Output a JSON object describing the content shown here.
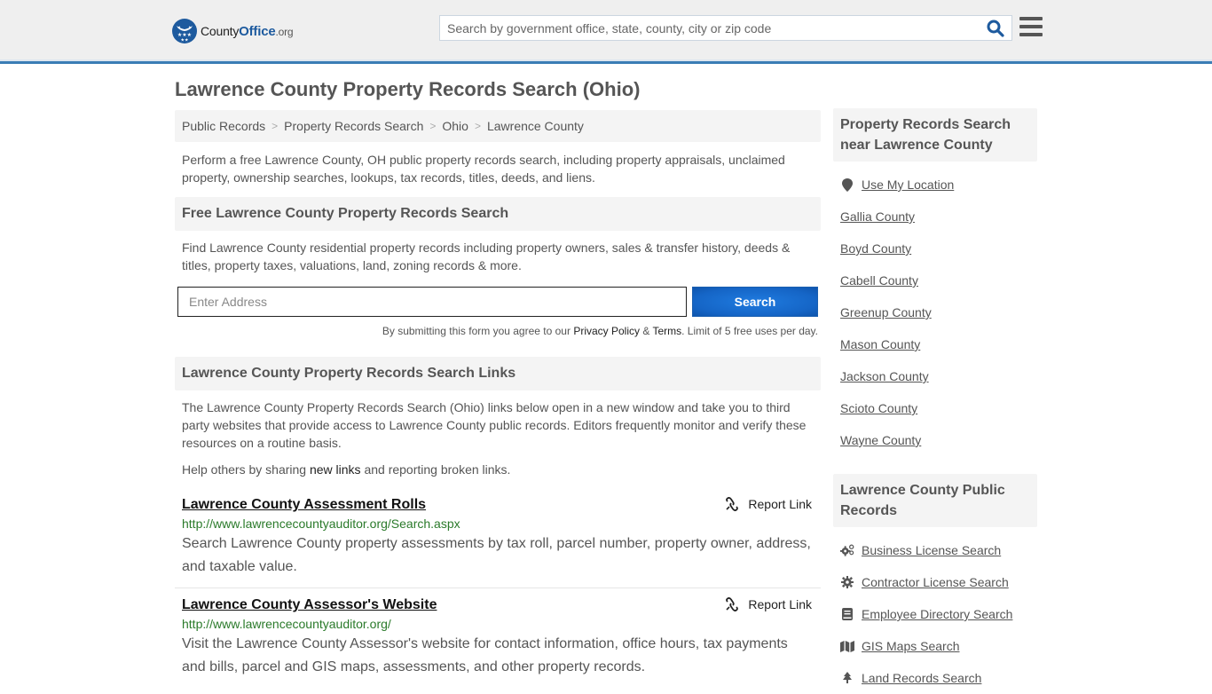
{
  "header": {
    "logo": {
      "name": "County",
      "name_bold": "Office",
      "tld": ".org"
    },
    "search_placeholder": "Search by government office, state, county, city or zip code",
    "search_icon": "magnifier-icon",
    "menu_icon": "hamburger-menu-icon"
  },
  "page_title": "Lawrence County Property Records Search (Ohio)",
  "breadcrumb": [
    "Public Records",
    "Property Records Search",
    "Ohio",
    "Lawrence County"
  ],
  "breadcrumb_separator": ">",
  "intro": "Perform a free Lawrence County, OH public property records search, including property appraisals, unclaimed property, ownership searches, lookups, tax records, titles, deeds, and liens.",
  "free_search": {
    "heading": "Free Lawrence County Property Records Search",
    "description": "Find Lawrence County residential property records including property owners, sales & transfer history, deeds & titles, property taxes, valuations, land, zoning records & more.",
    "address_placeholder": "Enter Address",
    "button_label": "Search",
    "disclaimer_prefix": "By submitting this form you agree to our ",
    "privacy_label": "Privacy Policy",
    "amp": " & ",
    "terms_label": "Terms",
    "disclaimer_suffix": ". Limit of 5 free uses per day."
  },
  "links_section": {
    "heading": "Lawrence County Property Records Search Links",
    "description": "The Lawrence County Property Records Search (Ohio) links below open in a new window and take you to third party websites that provide access to Lawrence County public records. Editors frequently monitor and verify these resources on a routine basis.",
    "help_prefix": "Help others by sharing ",
    "help_link": "new links",
    "help_suffix": " and reporting broken links.",
    "report_label": "Report Link",
    "items": [
      {
        "title": "Lawrence County Assessment Rolls",
        "url": "http://www.lawrencecountyauditor.org/Search.aspx",
        "description": "Search Lawrence County property assessments by tax roll, parcel number, property owner, address, and taxable value."
      },
      {
        "title": "Lawrence County Assessor's Website",
        "url": "http://www.lawrencecountyauditor.org/",
        "description": "Visit the Lawrence County Assessor's website for contact information, office hours, tax payments and bills, parcel and GIS maps, assessments, and other property records."
      }
    ]
  },
  "sidebar": {
    "nearby": {
      "heading": "Property Records Search near Lawrence County",
      "use_location": "Use My Location",
      "counties": [
        "Gallia County",
        "Boyd County",
        "Cabell County",
        "Greenup County",
        "Mason County",
        "Jackson County",
        "Scioto County",
        "Wayne County"
      ]
    },
    "public_records": {
      "heading": "Lawrence County Public Records",
      "items": [
        {
          "label": "Business License Search",
          "icon": "cogs-icon"
        },
        {
          "label": "Contractor License Search",
          "icon": "gear-icon"
        },
        {
          "label": "Employee Directory Search",
          "icon": "book-icon"
        },
        {
          "label": "GIS Maps Search",
          "icon": "map-icon"
        },
        {
          "label": "Land Records Search",
          "icon": "tree-icon"
        }
      ]
    }
  },
  "colors": {
    "accent_blue": "#1d5a9e",
    "header_border": "#3a7db5",
    "button_blue": "#1565c6",
    "url_green": "#2a7a2a",
    "section_bg": "#f4f4f4"
  }
}
